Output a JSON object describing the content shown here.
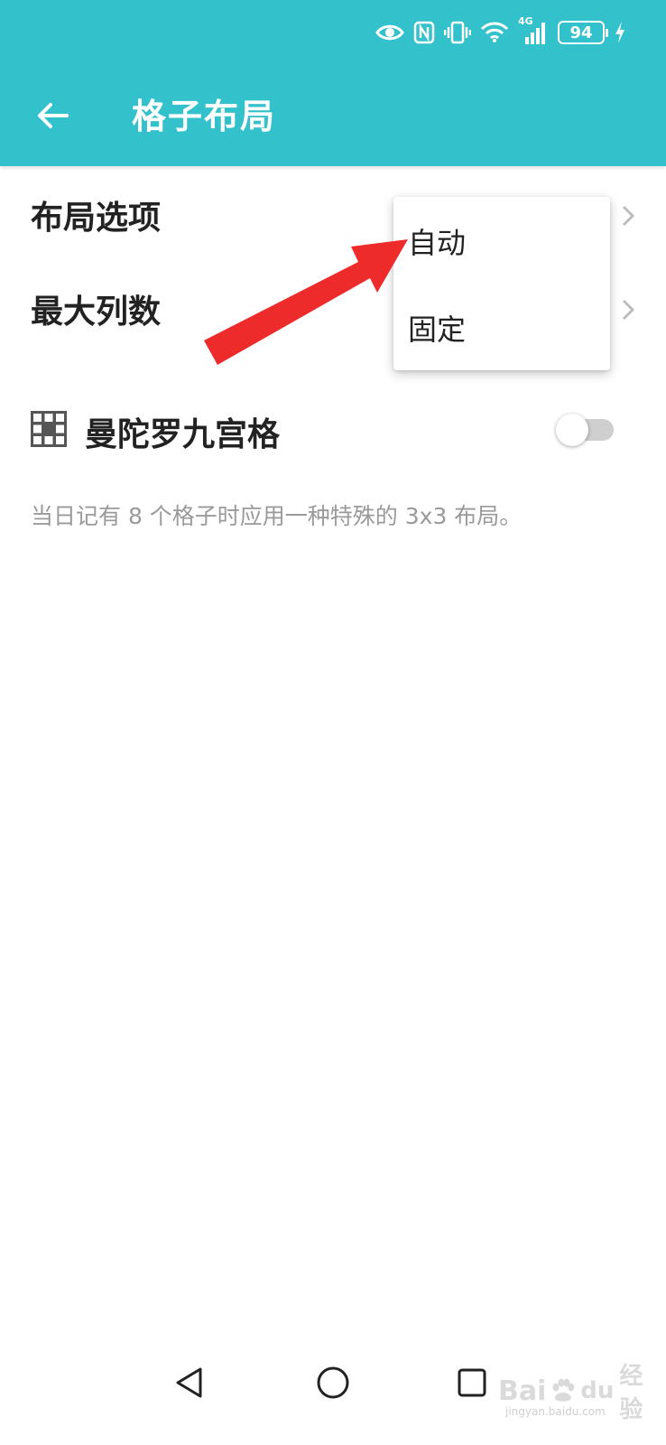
{
  "status_bar": {
    "network_label": "4G",
    "battery_level": "94",
    "icons": [
      "eye-comfort-icon",
      "nfc-icon",
      "vibrate-icon",
      "wifi-icon",
      "cellular-signal-icon",
      "battery-icon",
      "charging-icon"
    ]
  },
  "header": {
    "title": "格子布局",
    "back_icon": "back-arrow-icon",
    "background_color": "#33c1cb"
  },
  "settings": {
    "layout_option_label": "布局选项",
    "max_columns_label": "最大列数",
    "mandala_label": "曼陀罗九宫格",
    "mandala_icon": "grid-icon",
    "mandala_enabled": false,
    "mandala_description": "当日记有 8 个格子时应用一种特殊的 3x3 布局。"
  },
  "popup_menu": {
    "options": [
      "自动",
      "固定"
    ]
  },
  "annotation": {
    "arrow_color": "#ee2b2b",
    "points_to": "自动"
  },
  "nav_bar": {
    "icons": [
      "back-triangle-icon",
      "home-circle-icon",
      "recents-square-icon"
    ]
  },
  "watermark": {
    "brand": "Bai",
    "brand_suffix": "du",
    "product": "经验",
    "url": "jingyan.baidu.com"
  }
}
